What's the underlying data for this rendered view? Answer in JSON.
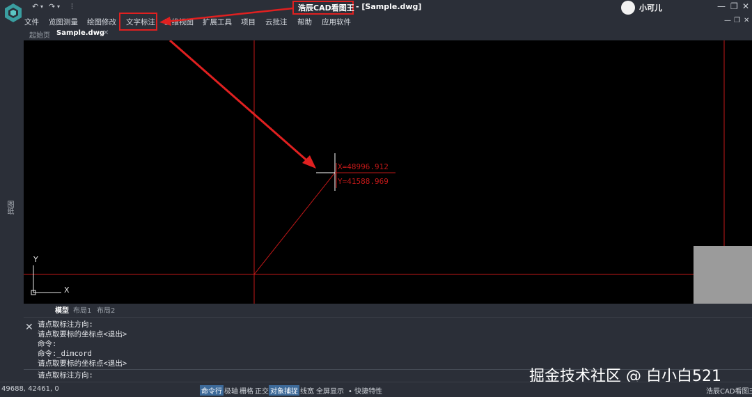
{
  "app": {
    "title": "浩辰CAD看图王",
    "file": "- [Sample.dwg]",
    "user": "小可儿",
    "quick_access": [
      "↶",
      "▾",
      "↷",
      "▾",
      "⫶"
    ],
    "window_controls": [
      "—",
      "❐",
      "✕"
    ],
    "mdi_controls": [
      "—",
      "❐",
      "✕"
    ]
  },
  "menu": {
    "items": [
      "文件",
      "览图测量",
      "绘图修改",
      "文字标注",
      "三维视图",
      "扩展工具",
      "项目",
      "云批注",
      "帮助",
      "应用软件"
    ]
  },
  "tabs": {
    "home": "起始页",
    "doc": "Sample.dwg",
    "close": "✕"
  },
  "left_panel": {
    "label": "图纸"
  },
  "canvas": {
    "coord_x": "X=48996.912",
    "coord_y": "Y=41588.969",
    "ucs_y": "Y",
    "ucs_x": "X"
  },
  "layout_tabs": [
    "模型",
    "布局1",
    "布局2"
  ],
  "command": {
    "close": "✕",
    "history": [
      "请点取标注方向:",
      "请点取要标的坐标点<退出>",
      "命令:",
      "命令:_dimcord",
      "请点取要标的坐标点<退出>"
    ],
    "prompt": "请点取标注方向:"
  },
  "watermark": "掘金技术社区 @ 白小白521",
  "status": {
    "coords": "49688, 42461, 0",
    "toggles": [
      {
        "label": "命令行",
        "on": true
      },
      {
        "label": "极轴",
        "on": false
      },
      {
        "label": "栅格",
        "on": false
      },
      {
        "label": "正交",
        "on": false
      },
      {
        "label": "对象捕捉",
        "on": true
      },
      {
        "label": "线宽",
        "on": false
      },
      {
        "label": "全屏显示",
        "on": false
      }
    ],
    "quick_props": "• 快捷特性",
    "app_name": "浩辰CAD看图王"
  },
  "colors": {
    "background": "#2b2f38",
    "canvas": "#000000",
    "drawing_line": "#c01818",
    "annotation": "#e02020",
    "toggle_on": "#3d6a99"
  }
}
